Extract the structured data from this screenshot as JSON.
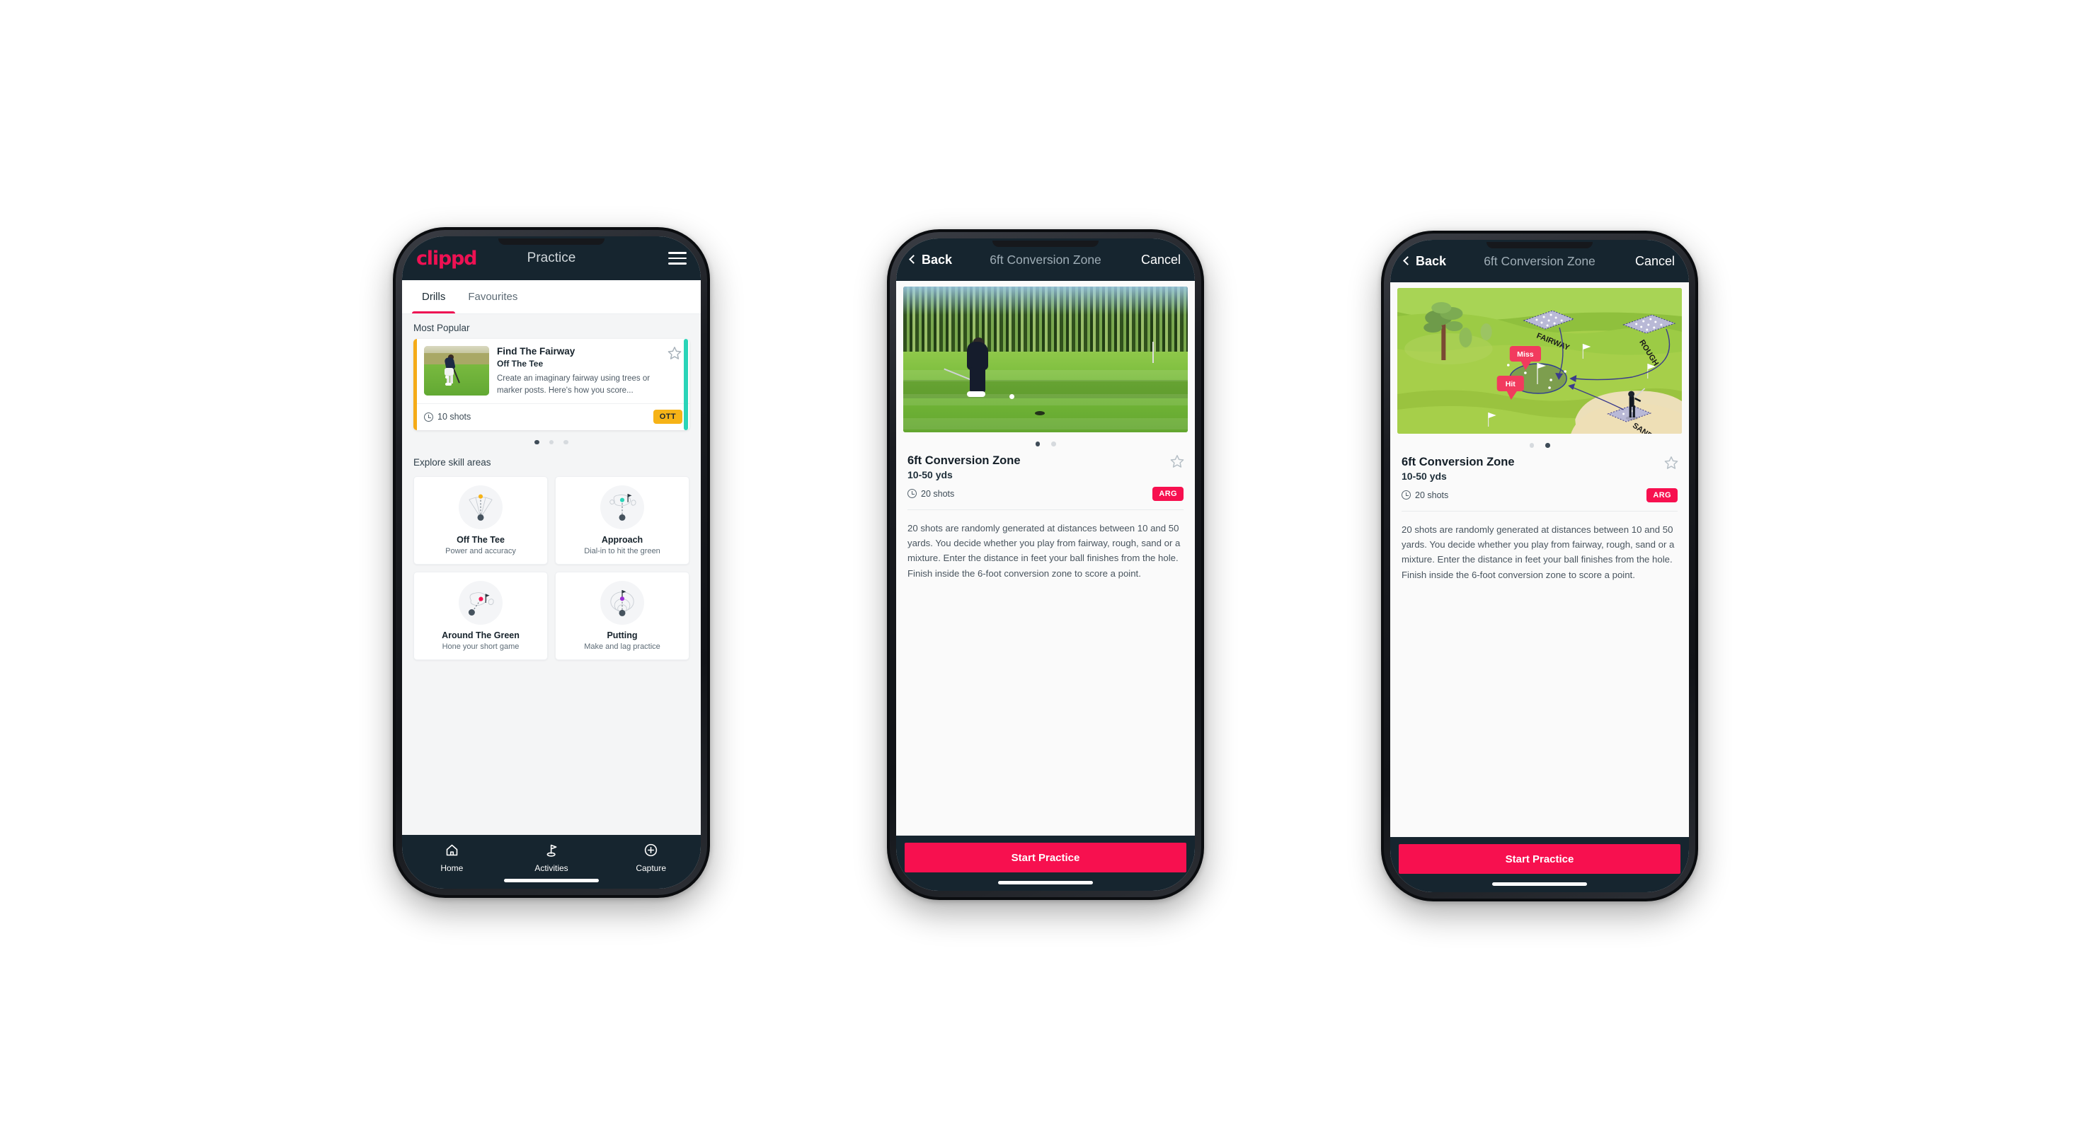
{
  "phone1": {
    "header": {
      "logo": "clippd",
      "title": "Practice",
      "menu_icon": "hamburger-icon"
    },
    "tabs": [
      {
        "label": "Drills",
        "active": true
      },
      {
        "label": "Favourites",
        "active": false
      }
    ],
    "most_popular_label": "Most Popular",
    "featured_card": {
      "title": "Find The Fairway",
      "subtitle": "Off The Tee",
      "description": "Create an imaginary fairway using trees or marker posts. Here's how you score...",
      "shots": "10 shots",
      "badge": "OTT",
      "badge_color": "#f6b317",
      "accent_color": "#f5ab18",
      "peek_color": "#2ad4b8"
    },
    "carousel_dots": 3,
    "carousel_active": 0,
    "explore_label": "Explore skill areas",
    "skills": [
      {
        "name": "Off The Tee",
        "desc": "Power and accuracy",
        "icon": "tee-fan-icon",
        "dot_color": "#f6b317"
      },
      {
        "name": "Approach",
        "desc": "Dial-in to hit the green",
        "icon": "green-approach-icon",
        "dot_color": "#2ad4b8"
      },
      {
        "name": "Around The Green",
        "desc": "Hone your short game",
        "icon": "chip-green-icon",
        "dot_color": "#f7104f"
      },
      {
        "name": "Putting",
        "desc": "Make and lag practice",
        "icon": "putt-rings-icon",
        "dot_color": "#9b2fd4"
      }
    ],
    "bottom_nav": [
      {
        "label": "Home",
        "icon": "home-icon",
        "active": false
      },
      {
        "label": "Activities",
        "icon": "golf-flag-icon",
        "active": true
      },
      {
        "label": "Capture",
        "icon": "plus-circle-icon",
        "active": false
      }
    ]
  },
  "phone2": {
    "nav": {
      "back": "Back",
      "title": "6ft Conversion Zone",
      "cancel": "Cancel"
    },
    "hero_type": "photo",
    "dots": 2,
    "dots_active": 0,
    "title": "6ft Conversion Zone",
    "yards": "10-50 yds",
    "shots": "20 shots",
    "badge": "ARG",
    "badge_color": "#f7104f",
    "description": "20 shots are randomly generated at distances between 10 and 50 yards. You decide whether you play from fairway, rough, sand or a mixture. Enter the distance in feet your ball finishes from the hole. Finish inside the 6-foot conversion zone to score a point.",
    "cta": "Start Practice"
  },
  "phone3": {
    "nav": {
      "back": "Back",
      "title": "6ft Conversion Zone",
      "cancel": "Cancel"
    },
    "hero_type": "illustration",
    "illustration_labels": {
      "fairway": "FAIRWAY",
      "rough": "ROUGH",
      "sand": "SAND",
      "miss": "Miss",
      "hit": "Hit"
    },
    "dots": 2,
    "dots_active": 1,
    "title": "6ft Conversion Zone",
    "yards": "10-50 yds",
    "shots": "20 shots",
    "badge": "ARG",
    "badge_color": "#f7104f",
    "description": "20 shots are randomly generated at distances between 10 and 50 yards. You decide whether you play from fairway, rough, sand or a mixture. Enter the distance in feet your ball finishes from the hole. Finish inside the 6-foot conversion zone to score a point.",
    "cta": "Start Practice"
  }
}
